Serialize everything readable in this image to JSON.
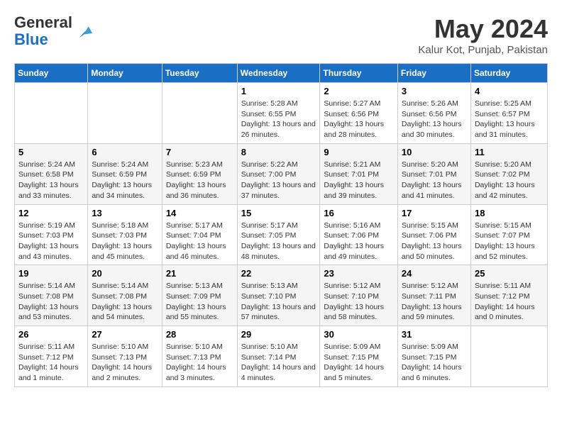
{
  "header": {
    "logo_line1": "General",
    "logo_line2": "Blue",
    "month": "May 2024",
    "location": "Kalur Kot, Punjab, Pakistan"
  },
  "weekdays": [
    "Sunday",
    "Monday",
    "Tuesday",
    "Wednesday",
    "Thursday",
    "Friday",
    "Saturday"
  ],
  "weeks": [
    [
      {
        "day": "",
        "sunrise": "",
        "sunset": "",
        "daylight": ""
      },
      {
        "day": "",
        "sunrise": "",
        "sunset": "",
        "daylight": ""
      },
      {
        "day": "",
        "sunrise": "",
        "sunset": "",
        "daylight": ""
      },
      {
        "day": "1",
        "sunrise": "Sunrise: 5:28 AM",
        "sunset": "Sunset: 6:55 PM",
        "daylight": "Daylight: 13 hours and 26 minutes."
      },
      {
        "day": "2",
        "sunrise": "Sunrise: 5:27 AM",
        "sunset": "Sunset: 6:56 PM",
        "daylight": "Daylight: 13 hours and 28 minutes."
      },
      {
        "day": "3",
        "sunrise": "Sunrise: 5:26 AM",
        "sunset": "Sunset: 6:56 PM",
        "daylight": "Daylight: 13 hours and 30 minutes."
      },
      {
        "day": "4",
        "sunrise": "Sunrise: 5:25 AM",
        "sunset": "Sunset: 6:57 PM",
        "daylight": "Daylight: 13 hours and 31 minutes."
      }
    ],
    [
      {
        "day": "5",
        "sunrise": "Sunrise: 5:24 AM",
        "sunset": "Sunset: 6:58 PM",
        "daylight": "Daylight: 13 hours and 33 minutes."
      },
      {
        "day": "6",
        "sunrise": "Sunrise: 5:24 AM",
        "sunset": "Sunset: 6:59 PM",
        "daylight": "Daylight: 13 hours and 34 minutes."
      },
      {
        "day": "7",
        "sunrise": "Sunrise: 5:23 AM",
        "sunset": "Sunset: 6:59 PM",
        "daylight": "Daylight: 13 hours and 36 minutes."
      },
      {
        "day": "8",
        "sunrise": "Sunrise: 5:22 AM",
        "sunset": "Sunset: 7:00 PM",
        "daylight": "Daylight: 13 hours and 37 minutes."
      },
      {
        "day": "9",
        "sunrise": "Sunrise: 5:21 AM",
        "sunset": "Sunset: 7:01 PM",
        "daylight": "Daylight: 13 hours and 39 minutes."
      },
      {
        "day": "10",
        "sunrise": "Sunrise: 5:20 AM",
        "sunset": "Sunset: 7:01 PM",
        "daylight": "Daylight: 13 hours and 41 minutes."
      },
      {
        "day": "11",
        "sunrise": "Sunrise: 5:20 AM",
        "sunset": "Sunset: 7:02 PM",
        "daylight": "Daylight: 13 hours and 42 minutes."
      }
    ],
    [
      {
        "day": "12",
        "sunrise": "Sunrise: 5:19 AM",
        "sunset": "Sunset: 7:03 PM",
        "daylight": "Daylight: 13 hours and 43 minutes."
      },
      {
        "day": "13",
        "sunrise": "Sunrise: 5:18 AM",
        "sunset": "Sunset: 7:03 PM",
        "daylight": "Daylight: 13 hours and 45 minutes."
      },
      {
        "day": "14",
        "sunrise": "Sunrise: 5:17 AM",
        "sunset": "Sunset: 7:04 PM",
        "daylight": "Daylight: 13 hours and 46 minutes."
      },
      {
        "day": "15",
        "sunrise": "Sunrise: 5:17 AM",
        "sunset": "Sunset: 7:05 PM",
        "daylight": "Daylight: 13 hours and 48 minutes."
      },
      {
        "day": "16",
        "sunrise": "Sunrise: 5:16 AM",
        "sunset": "Sunset: 7:06 PM",
        "daylight": "Daylight: 13 hours and 49 minutes."
      },
      {
        "day": "17",
        "sunrise": "Sunrise: 5:15 AM",
        "sunset": "Sunset: 7:06 PM",
        "daylight": "Daylight: 13 hours and 50 minutes."
      },
      {
        "day": "18",
        "sunrise": "Sunrise: 5:15 AM",
        "sunset": "Sunset: 7:07 PM",
        "daylight": "Daylight: 13 hours and 52 minutes."
      }
    ],
    [
      {
        "day": "19",
        "sunrise": "Sunrise: 5:14 AM",
        "sunset": "Sunset: 7:08 PM",
        "daylight": "Daylight: 13 hours and 53 minutes."
      },
      {
        "day": "20",
        "sunrise": "Sunrise: 5:14 AM",
        "sunset": "Sunset: 7:08 PM",
        "daylight": "Daylight: 13 hours and 54 minutes."
      },
      {
        "day": "21",
        "sunrise": "Sunrise: 5:13 AM",
        "sunset": "Sunset: 7:09 PM",
        "daylight": "Daylight: 13 hours and 55 minutes."
      },
      {
        "day": "22",
        "sunrise": "Sunrise: 5:13 AM",
        "sunset": "Sunset: 7:10 PM",
        "daylight": "Daylight: 13 hours and 57 minutes."
      },
      {
        "day": "23",
        "sunrise": "Sunrise: 5:12 AM",
        "sunset": "Sunset: 7:10 PM",
        "daylight": "Daylight: 13 hours and 58 minutes."
      },
      {
        "day": "24",
        "sunrise": "Sunrise: 5:12 AM",
        "sunset": "Sunset: 7:11 PM",
        "daylight": "Daylight: 13 hours and 59 minutes."
      },
      {
        "day": "25",
        "sunrise": "Sunrise: 5:11 AM",
        "sunset": "Sunset: 7:12 PM",
        "daylight": "Daylight: 14 hours and 0 minutes."
      }
    ],
    [
      {
        "day": "26",
        "sunrise": "Sunrise: 5:11 AM",
        "sunset": "Sunset: 7:12 PM",
        "daylight": "Daylight: 14 hours and 1 minute."
      },
      {
        "day": "27",
        "sunrise": "Sunrise: 5:10 AM",
        "sunset": "Sunset: 7:13 PM",
        "daylight": "Daylight: 14 hours and 2 minutes."
      },
      {
        "day": "28",
        "sunrise": "Sunrise: 5:10 AM",
        "sunset": "Sunset: 7:13 PM",
        "daylight": "Daylight: 14 hours and 3 minutes."
      },
      {
        "day": "29",
        "sunrise": "Sunrise: 5:10 AM",
        "sunset": "Sunset: 7:14 PM",
        "daylight": "Daylight: 14 hours and 4 minutes."
      },
      {
        "day": "30",
        "sunrise": "Sunrise: 5:09 AM",
        "sunset": "Sunset: 7:15 PM",
        "daylight": "Daylight: 14 hours and 5 minutes."
      },
      {
        "day": "31",
        "sunrise": "Sunrise: 5:09 AM",
        "sunset": "Sunset: 7:15 PM",
        "daylight": "Daylight: 14 hours and 6 minutes."
      },
      {
        "day": "",
        "sunrise": "",
        "sunset": "",
        "daylight": ""
      }
    ]
  ]
}
